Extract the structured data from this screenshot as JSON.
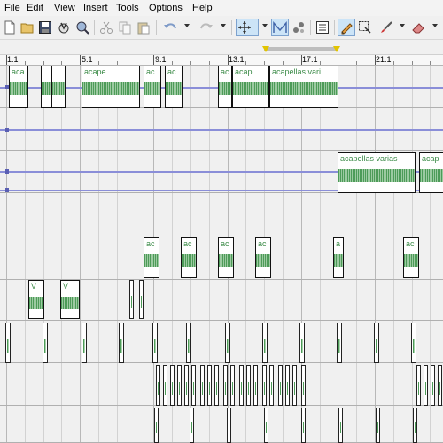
{
  "menu": [
    "File",
    "Edit",
    "View",
    "Insert",
    "Tools",
    "Options",
    "Help"
  ],
  "toolbar": {
    "buttons": [
      "new-file-icon",
      "open-folder-icon",
      "save-icon",
      "render-icon",
      "properties-icon",
      "cut-icon",
      "copy-icon",
      "paste-icon",
      "undo-icon",
      "redo-icon",
      "normal-edit-tool-icon",
      "envelope-tool-icon",
      "selection-tool-icon",
      "track-list-icon",
      "draw-tool-icon",
      "selection-edit-icon",
      "brush-tool-icon",
      "eraser-tool-icon"
    ],
    "active": [
      "normal-edit-tool-icon",
      "envelope-tool-icon",
      "draw-tool-icon"
    ]
  },
  "ruler": {
    "labels": [
      "1.1",
      "5.1",
      "9.1",
      "13.1",
      "17.1",
      "21.1"
    ]
  },
  "clips": {
    "track1_labels": [
      "acape",
      "acapellas vari",
      "acap",
      "aca",
      "ac"
    ],
    "track3_labels": [
      "acapellas varias",
      "acap"
    ],
    "track4_labels": [
      "ac",
      "ac",
      "ac",
      "ac",
      "a",
      "ac"
    ],
    "track5_labels": [
      "V",
      "V"
    ]
  },
  "colors": {
    "waveform": "#4d9b58",
    "clip_label": "#3b8b47",
    "volume_line": "#8a8ed8",
    "active_tool_bg": "#cce4f7",
    "loop_marker": "#e2c400"
  }
}
